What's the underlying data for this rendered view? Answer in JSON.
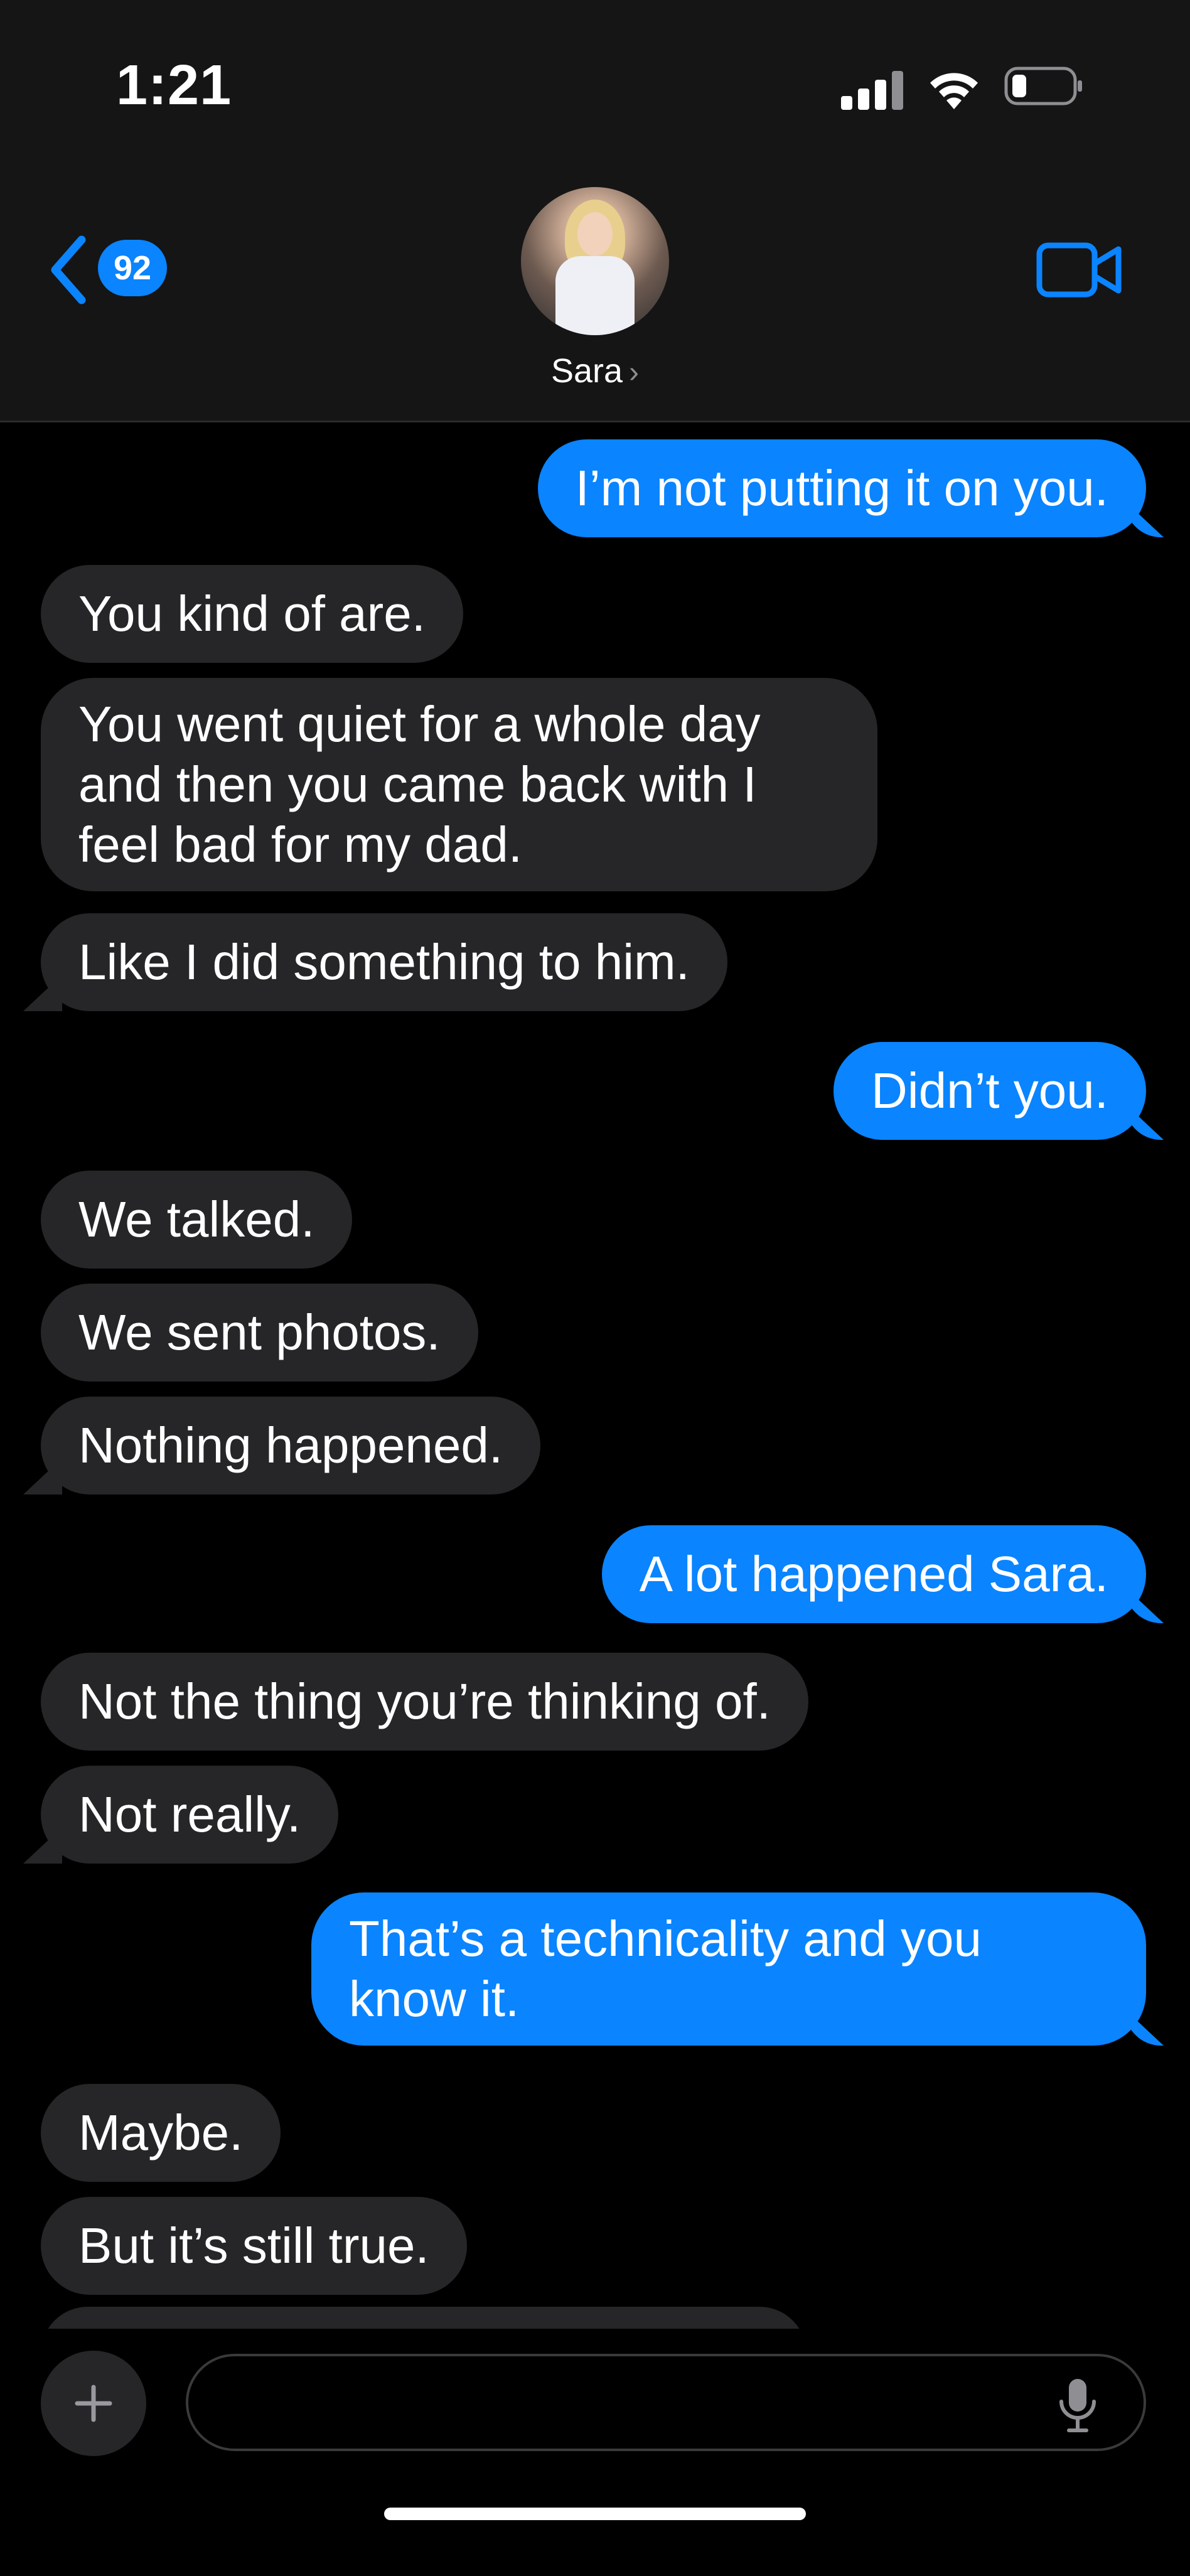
{
  "status": {
    "time": "1:21"
  },
  "header": {
    "back_count": "92",
    "contact_name": "Sara"
  },
  "messages": [
    {
      "from": "me",
      "text": "I’m not putting it on you."
    },
    {
      "from": "them",
      "text": "You kind of are."
    },
    {
      "from": "them",
      "text": "You went quiet for a whole day and then you came back with I feel bad for my dad."
    },
    {
      "from": "them",
      "text": "Like I did something to him."
    },
    {
      "from": "me",
      "text": "Didn’t you."
    },
    {
      "from": "them",
      "text": "We talked."
    },
    {
      "from": "them",
      "text": "We sent photos."
    },
    {
      "from": "them",
      "text": "Nothing happened."
    },
    {
      "from": "me",
      "text": "A lot happened Sara."
    },
    {
      "from": "them",
      "text": "Not the thing you’re thinking of."
    },
    {
      "from": "them",
      "text": "Not really."
    },
    {
      "from": "me",
      "text": "That’s a technicality and you know it."
    },
    {
      "from": "them",
      "text": "Maybe."
    },
    {
      "from": "them",
      "text": "But it’s still true."
    }
  ],
  "colors": {
    "sent_bubble": "#0a84ff",
    "received_bubble": "#262628",
    "accent": "#0a84ff"
  },
  "icons": {
    "back": "chevron-left-icon",
    "video": "video-camera-icon",
    "plus": "plus-icon",
    "mic": "microphone-icon"
  }
}
